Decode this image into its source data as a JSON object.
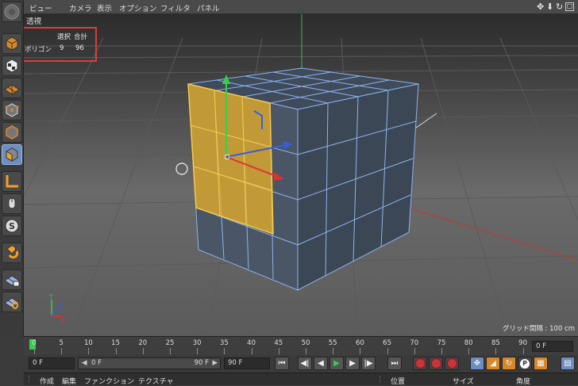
{
  "menubar": {
    "items": [
      "ビュー",
      "カメラ",
      "表示",
      "オプション",
      "フィルタ",
      "パネル"
    ],
    "nav_icons": [
      "move-view-icon",
      "down-arrow-icon",
      "rotate-view-icon",
      "maximize-view-icon"
    ]
  },
  "left_toolbar": {
    "tools": [
      {
        "icon": "model-mode-icon",
        "active": false
      },
      {
        "icon": "texture-mode-icon",
        "active": false
      },
      {
        "icon": "workplane-icon",
        "active": false
      },
      {
        "icon": "point-mode-icon",
        "active": false
      },
      {
        "icon": "edge-mode-icon",
        "active": false
      },
      {
        "icon": "polygon-mode-icon",
        "active": true
      },
      {
        "icon": "axis-mode-icon",
        "active": false
      },
      {
        "icon": "tweak-mode-icon",
        "active": false
      },
      {
        "icon": "snap-icon",
        "active": false
      },
      {
        "icon": "magnet-icon",
        "active": false
      },
      {
        "icon": "lock-workplane-icon",
        "active": false
      },
      {
        "icon": "planar-workplane-icon",
        "active": false
      }
    ]
  },
  "viewport": {
    "title": "透視",
    "stats": {
      "header_select": "選択",
      "header_total": "合計",
      "row_label": "ポリゴン",
      "selected": "9",
      "total": "96"
    },
    "grid_info": "グリッド間隔 : 100 cm",
    "axis_labels": {
      "y": "Y",
      "z": "Z",
      "x": "X"
    }
  },
  "timeline": {
    "ticks": [
      "0",
      "5",
      "10",
      "15",
      "20",
      "25",
      "30",
      "35",
      "40",
      "45",
      "50",
      "55",
      "60",
      "65",
      "70",
      "75",
      "80",
      "85",
      "90"
    ],
    "end_field": "0 F"
  },
  "transport": {
    "current_frame": "0 F",
    "range_start": "0 F",
    "range_end": "90 F",
    "max_frame": "90 F",
    "buttons": [
      {
        "icon": "go-to-start-icon",
        "glyph": "⏮"
      },
      {
        "icon": "prev-keyframe-icon",
        "glyph": "◀|"
      },
      {
        "icon": "prev-frame-icon",
        "glyph": "◀"
      },
      {
        "icon": "play-icon",
        "glyph": "▶"
      },
      {
        "icon": "next-frame-icon",
        "glyph": "▶"
      },
      {
        "icon": "next-keyframe-icon",
        "glyph": "|▶"
      },
      {
        "icon": "go-to-end-icon",
        "glyph": "⏭"
      }
    ]
  },
  "bottom_bar": {
    "left_items": [
      "作成",
      "編集",
      "ファンクション",
      "テクスチャ"
    ],
    "right_items": [
      "位置",
      "サイズ",
      "角度"
    ]
  },
  "colors": {
    "selection": "#f0b324",
    "accent": "#6d8ec2",
    "record": "#c8343a",
    "wireframe": "#8db3ee",
    "highlight_box": "#e03a3a"
  }
}
